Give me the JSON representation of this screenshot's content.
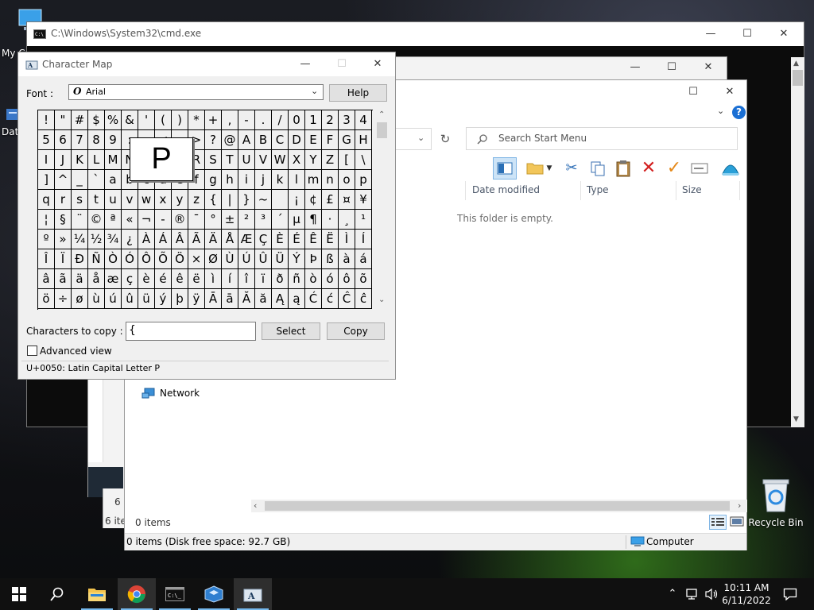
{
  "desktop": {
    "icons": [
      {
        "label": "My C"
      },
      {
        "label": "Dat"
      },
      {
        "label": "Recycle Bin"
      }
    ]
  },
  "cmd_window": {
    "title": "C:\\Windows\\System32\\cmd.exe"
  },
  "bg_window": {
    "status_a": "6 i",
    "status_b": "6 ite"
  },
  "explorer": {
    "search_placeholder": "Search Start Menu",
    "columns": [
      "Date modified",
      "Type",
      "Size"
    ],
    "empty_text": "This folder is empty.",
    "nav_network": "Network",
    "items_count": "0 items",
    "status_text": "0 items (Disk free space: 92.7 GB)",
    "status_computer": "Computer"
  },
  "charmap": {
    "title": "Character Map",
    "font_label": "Font :",
    "font_value": "Arial",
    "help_label": "Help",
    "copy_label_text": "Characters to copy :",
    "copy_value": "{",
    "select_label": "Select",
    "copy_label": "Copy",
    "advanced_view_label": "Advanced view",
    "status_text": "U+0050: Latin Capital Letter P",
    "magnified_char": "P",
    "grid": [
      [
        "!",
        "\"",
        "#",
        "$",
        "%",
        "&",
        "'",
        "(",
        ")",
        "*",
        "+",
        ",",
        "-",
        ".",
        "/",
        "0",
        "1",
        "2",
        "3",
        "4"
      ],
      [
        "5",
        "6",
        "7",
        "8",
        "9",
        ":",
        ";",
        "<",
        "=",
        ">",
        "?",
        "@",
        "A",
        "B",
        "C",
        "D",
        "E",
        "F",
        "G",
        "H"
      ],
      [
        "I",
        "J",
        "K",
        "L",
        "M",
        "N",
        "O",
        "P",
        "Q",
        "R",
        "S",
        "T",
        "U",
        "V",
        "W",
        "X",
        "Y",
        "Z",
        "[",
        "\\"
      ],
      [
        "]",
        "^",
        "_",
        "`",
        "a",
        "b",
        "c",
        "d",
        "e",
        "f",
        "g",
        "h",
        "i",
        "j",
        "k",
        "l",
        "m",
        "n",
        "o",
        "p"
      ],
      [
        "q",
        "r",
        "s",
        "t",
        "u",
        "v",
        "w",
        "x",
        "y",
        "z",
        "{",
        "|",
        "}",
        "~",
        " ",
        "¡",
        "¢",
        "£",
        "¤",
        "¥"
      ],
      [
        "¦",
        "§",
        "¨",
        "©",
        "ª",
        "«",
        "¬",
        "-",
        "®",
        "¯",
        "°",
        "±",
        "²",
        "³",
        "´",
        "µ",
        "¶",
        "·",
        "¸",
        "¹"
      ],
      [
        "º",
        "»",
        "¼",
        "½",
        "¾",
        "¿",
        "À",
        "Á",
        "Â",
        "Ã",
        "Ä",
        "Å",
        "Æ",
        "Ç",
        "È",
        "É",
        "Ê",
        "Ë",
        "Ì",
        "Í"
      ],
      [
        "Î",
        "Ï",
        "Ð",
        "Ñ",
        "Ò",
        "Ó",
        "Ô",
        "Õ",
        "Ö",
        "×",
        "Ø",
        "Ù",
        "Ú",
        "Û",
        "Ü",
        "Ý",
        "Þ",
        "ß",
        "à",
        "á"
      ],
      [
        "â",
        "ã",
        "ä",
        "å",
        "æ",
        "ç",
        "è",
        "é",
        "ê",
        "ë",
        "ì",
        "í",
        "î",
        "ï",
        "ð",
        "ñ",
        "ò",
        "ó",
        "ô",
        "õ"
      ],
      [
        "ö",
        "÷",
        "ø",
        "ù",
        "ú",
        "û",
        "ü",
        "ý",
        "þ",
        "ÿ",
        "Ā",
        "ā",
        "Ă",
        "ă",
        "Ą",
        "ą",
        "Ć",
        "ć",
        "Ĉ",
        "ĉ"
      ]
    ]
  },
  "taskbar": {
    "time": "10:11 AM",
    "date": "6/11/2022"
  },
  "colors": {
    "accent": "#0078d7",
    "delete_red": "#d21f1f",
    "check_orange": "#e5891a"
  }
}
